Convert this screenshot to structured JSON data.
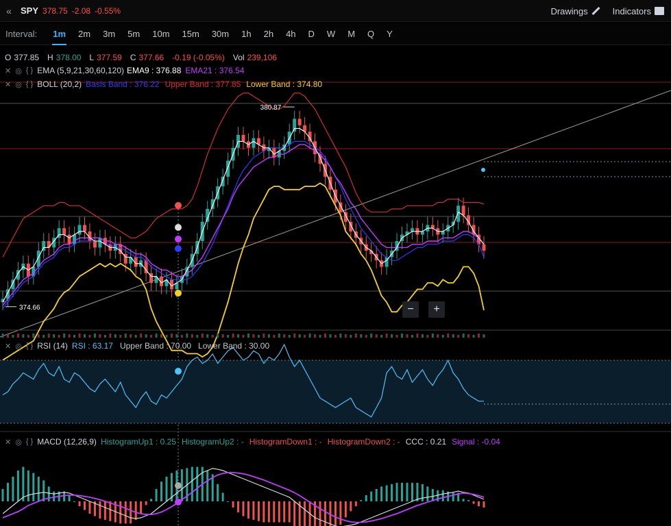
{
  "header": {
    "symbol": "SPY",
    "last": "378.75",
    "change": "-2.08",
    "change_pct": "-0.55%",
    "drawings_label": "Drawings",
    "indicators_label": "Indicators"
  },
  "intervals": {
    "label": "Interval:",
    "items": [
      "1m",
      "2m",
      "3m",
      "5m",
      "10m",
      "15m",
      "30m",
      "1h",
      "2h",
      "4h",
      "D",
      "W",
      "M",
      "Q",
      "Y"
    ],
    "active": "1m"
  },
  "ohlc": {
    "o_label": "O",
    "o": "377.85",
    "h_label": "H",
    "h": "378.00",
    "l_label": "L",
    "l": "377.59",
    "c_label": "C",
    "c": "377.66",
    "chg": "-0.19 (-0.05%)",
    "vol_label": "Vol",
    "vol": "239,106"
  },
  "studies": {
    "ema": {
      "name": "EMA (5,9,21,30,60,120)",
      "ema9": "EMA9 : 376.88",
      "ema21": "EMA21 : 376.54"
    },
    "boll": {
      "name": "BOLL (20,2)",
      "basis": "Basis Band : 376.22",
      "upper": "Upper Band : 377.85",
      "lower": "Lower Band : 374.80"
    },
    "rsi": {
      "name": "RSI (14)",
      "value": "RSI : 63.17",
      "upper": "Upper Band : 70.00",
      "lower": "Lower Band : 30.00"
    },
    "macd": {
      "name": "MACD (12,26,9)",
      "hu1": "HistogramUp1 : 0.25",
      "hu2": "HistogramUp2 : -",
      "hd1": "HistogramDown1 : -",
      "hd2": "HistogramDown2 : -",
      "ccc": "CCC : 0.21",
      "signal": "Signal : -0.04"
    }
  },
  "price_labels": {
    "high": "380.87",
    "low": "374.66"
  },
  "zoom": {
    "minus": "−",
    "plus": "+"
  },
  "colors": {
    "up": "#26a69a",
    "down": "#ef5350",
    "ema_fast": "#ffffff",
    "ema9": "#b0b0ff",
    "ema21": "#c03cff",
    "basis": "#2f3cff",
    "upper": "#d32f2f",
    "lower": "#f5d21e",
    "rsi": "#4fc3f7",
    "macd": "#dddddd",
    "signal": "#c03cff"
  },
  "chart_data": {
    "type": "candlestick",
    "price_series": {
      "name": "SPY",
      "close": [
        374.9,
        375.2,
        375.5,
        375.8,
        376.0,
        375.6,
        375.9,
        376.4,
        376.7,
        376.5,
        376.8,
        377.1,
        376.9,
        376.6,
        376.9,
        377.2,
        377.0,
        376.7,
        376.5,
        376.8,
        376.6,
        376.4,
        376.6,
        376.3,
        376.0,
        376.2,
        375.9,
        376.1,
        375.7,
        375.4,
        375.6,
        375.3,
        375.5,
        375.2,
        375.4,
        375.6,
        375.9,
        376.3,
        376.7,
        377.3,
        377.7,
        378.0,
        378.4,
        378.7,
        379.2,
        379.6,
        380.0,
        379.8,
        379.6,
        379.9,
        379.7,
        379.5,
        379.6,
        379.3,
        379.5,
        379.7,
        380.1,
        380.5,
        380.3,
        380.1,
        379.8,
        379.4,
        379.1,
        378.7,
        378.3,
        377.9,
        377.6,
        377.3,
        377.0,
        376.8,
        376.6,
        376.4,
        376.3,
        376.1,
        375.9,
        376.2,
        376.4,
        376.7,
        376.9,
        377.0,
        377.1,
        376.9,
        377.0,
        377.2,
        377.1,
        376.9,
        377.0,
        377.2,
        377.3,
        377.8,
        377.5,
        377.2,
        376.9,
        376.6,
        376.4
      ]
    },
    "ema_fast": [
      374.8,
      375.1,
      375.4,
      375.7,
      375.9,
      375.8,
      375.9,
      376.2,
      376.5,
      376.5,
      376.7,
      376.9,
      376.9,
      376.8,
      376.9,
      377.0,
      377.0,
      376.8,
      376.7,
      376.7,
      376.6,
      376.5,
      376.5,
      376.4,
      376.2,
      376.2,
      376.0,
      376.0,
      375.8,
      375.6,
      375.6,
      375.4,
      375.5,
      375.3,
      375.4,
      375.5,
      375.8,
      376.1,
      376.5,
      377.0,
      377.4,
      377.8,
      378.2,
      378.6,
      379.0,
      379.4,
      379.8,
      379.8,
      379.7,
      379.8,
      379.7,
      379.6,
      379.6,
      379.4,
      379.5,
      379.6,
      379.9,
      380.2,
      380.2,
      380.1,
      379.9,
      379.6,
      379.3,
      378.9,
      378.5,
      378.1,
      377.8,
      377.5,
      377.2,
      376.9,
      376.7,
      376.5,
      376.4,
      376.2,
      376.0,
      376.1,
      376.3,
      376.5,
      376.8,
      376.9,
      377.0,
      377.0,
      377.0,
      377.1,
      377.1,
      377.0,
      377.0,
      377.1,
      377.2,
      377.6,
      377.5,
      377.3,
      377.0,
      376.8,
      376.6
    ],
    "ema21": [
      374.7,
      374.9,
      375.1,
      375.3,
      375.5,
      375.6,
      375.7,
      375.9,
      376.1,
      376.2,
      376.3,
      376.5,
      376.6,
      376.6,
      376.7,
      376.8,
      376.8,
      376.8,
      376.8,
      376.8,
      376.7,
      376.7,
      376.6,
      376.6,
      376.5,
      376.4,
      376.3,
      376.3,
      376.2,
      376.0,
      375.9,
      375.8,
      375.8,
      375.7,
      375.6,
      375.6,
      375.7,
      375.8,
      376.0,
      376.2,
      376.5,
      376.8,
      377.1,
      377.4,
      377.7,
      378.1,
      378.4,
      378.6,
      378.8,
      379.0,
      379.1,
      379.2,
      379.3,
      379.3,
      379.4,
      379.4,
      379.5,
      379.6,
      379.7,
      379.7,
      379.6,
      379.5,
      379.4,
      379.2,
      379.0,
      378.7,
      378.5,
      378.2,
      377.9,
      377.7,
      377.4,
      377.2,
      377.0,
      376.8,
      376.6,
      376.5,
      376.5,
      376.5,
      376.5,
      376.5,
      376.6,
      376.6,
      376.6,
      376.7,
      376.7,
      376.7,
      376.8,
      376.8,
      376.8,
      376.9,
      377.0,
      377.0,
      376.9,
      376.8,
      376.6
    ],
    "basis": [
      374.6,
      374.8,
      375.0,
      375.2,
      375.4,
      375.5,
      375.6,
      375.8,
      376.0,
      376.1,
      376.2,
      376.4,
      376.5,
      376.5,
      376.6,
      376.7,
      376.7,
      376.7,
      376.7,
      376.7,
      376.6,
      376.6,
      376.5,
      376.5,
      376.4,
      376.3,
      376.2,
      376.2,
      376.1,
      375.9,
      375.8,
      375.7,
      375.6,
      375.5,
      375.5,
      375.5,
      375.5,
      375.6,
      375.8,
      376.0,
      376.3,
      376.6,
      377.0,
      377.4,
      377.8,
      378.2,
      378.6,
      378.9,
      379.1,
      379.3,
      379.4,
      379.5,
      379.6,
      379.6,
      379.6,
      379.6,
      379.7,
      379.8,
      379.8,
      379.8,
      379.7,
      379.6,
      379.5,
      379.3,
      379.0,
      378.7,
      378.4,
      378.0,
      377.7,
      377.4,
      377.1,
      376.9,
      376.7,
      376.5,
      376.3,
      376.2,
      376.1,
      376.1,
      376.2,
      376.3,
      376.4,
      376.5,
      376.5,
      376.6,
      376.6,
      376.6,
      376.7,
      376.7,
      376.7,
      376.8,
      376.9,
      376.9,
      376.8,
      376.6,
      376.2
    ],
    "upper": [
      376.2,
      376.5,
      376.8,
      377.1,
      377.4,
      377.5,
      377.6,
      377.7,
      377.8,
      377.8,
      377.8,
      377.9,
      377.9,
      377.8,
      377.8,
      377.8,
      377.7,
      377.6,
      377.5,
      377.4,
      377.3,
      377.2,
      377.1,
      377.0,
      376.9,
      376.8,
      376.8,
      376.9,
      377.0,
      377.2,
      377.4,
      377.5,
      377.6,
      377.7,
      377.7,
      377.7,
      377.8,
      378.0,
      378.4,
      378.9,
      379.4,
      379.8,
      380.2,
      380.5,
      380.8,
      381.0,
      381.2,
      381.3,
      381.3,
      381.2,
      381.1,
      381.0,
      380.9,
      380.8,
      380.8,
      380.9,
      381.1,
      381.3,
      381.3,
      381.2,
      381.0,
      380.8,
      380.5,
      380.2,
      379.9,
      379.6,
      379.3,
      379.0,
      378.6,
      378.2,
      377.9,
      377.7,
      377.6,
      377.6,
      377.6,
      377.6,
      377.7,
      377.7,
      377.7,
      377.8,
      377.8,
      377.8,
      377.8,
      377.8,
      377.8,
      377.9,
      377.9,
      378.0,
      378.0,
      378.0,
      377.9,
      377.9,
      377.9,
      377.9,
      377.85
    ]
  },
  "rsi_series": [
    48,
    50,
    55,
    58,
    62,
    60,
    58,
    64,
    68,
    62,
    60,
    66,
    58,
    56,
    62,
    60,
    56,
    52,
    50,
    55,
    58,
    54,
    50,
    56,
    48,
    44,
    40,
    46,
    50,
    44,
    42,
    48,
    46,
    50,
    54,
    58,
    66,
    70,
    72,
    68,
    70,
    74,
    68,
    72,
    76,
    78,
    74,
    70,
    72,
    76,
    74,
    68,
    72,
    70,
    74,
    80,
    72,
    66,
    70,
    64,
    58,
    52,
    46,
    44,
    42,
    40,
    42,
    44,
    46,
    40,
    38,
    36,
    34,
    40,
    46,
    62,
    66,
    60,
    58,
    64,
    56,
    60,
    64,
    58,
    54,
    60,
    64,
    70,
    62,
    58,
    52,
    48,
    46,
    44,
    44
  ],
  "macd_series": [
    -0.3,
    -0.2,
    -0.1,
    0.0,
    0.1,
    0.15,
    0.18,
    0.2,
    0.22,
    0.2,
    0.18,
    0.2,
    0.22,
    0.2,
    0.15,
    0.1,
    0.05,
    0.0,
    -0.05,
    -0.1,
    -0.15,
    -0.2,
    -0.25,
    -0.3,
    -0.35,
    -0.4,
    -0.42,
    -0.4,
    -0.35,
    -0.3,
    -0.2,
    -0.1,
    0.0,
    0.1,
    0.2,
    0.3,
    0.4,
    0.5,
    0.6,
    0.7,
    0.75,
    0.8,
    0.78,
    0.75,
    0.7,
    0.65,
    0.6,
    0.55,
    0.5,
    0.45,
    0.4,
    0.35,
    0.3,
    0.25,
    0.2,
    0.15,
    0.1,
    0.0,
    -0.1,
    -0.2,
    -0.3,
    -0.4,
    -0.45,
    -0.5,
    -0.55,
    -0.6,
    -0.62,
    -0.6,
    -0.58,
    -0.55,
    -0.5,
    -0.45,
    -0.4,
    -0.35,
    -0.3,
    -0.25,
    -0.2,
    -0.15,
    -0.1,
    -0.05,
    0.0,
    0.05,
    0.08,
    0.1,
    0.12,
    0.15,
    0.18,
    0.2,
    0.22,
    0.25,
    0.22,
    0.2,
    0.15,
    0.1,
    0.05
  ],
  "signal_series": [
    -0.4,
    -0.35,
    -0.3,
    -0.25,
    -0.18,
    -0.1,
    -0.05,
    0.0,
    0.05,
    0.08,
    0.1,
    0.12,
    0.14,
    0.15,
    0.15,
    0.14,
    0.12,
    0.1,
    0.07,
    0.04,
    0.0,
    -0.04,
    -0.08,
    -0.12,
    -0.17,
    -0.22,
    -0.27,
    -0.3,
    -0.32,
    -0.32,
    -0.3,
    -0.26,
    -0.2,
    -0.13,
    -0.05,
    0.04,
    0.13,
    0.22,
    0.32,
    0.42,
    0.5,
    0.58,
    0.64,
    0.68,
    0.7,
    0.7,
    0.69,
    0.67,
    0.64,
    0.6,
    0.56,
    0.52,
    0.47,
    0.42,
    0.37,
    0.32,
    0.27,
    0.21,
    0.14,
    0.06,
    -0.02,
    -0.1,
    -0.18,
    -0.25,
    -0.32,
    -0.38,
    -0.43,
    -0.47,
    -0.5,
    -0.51,
    -0.51,
    -0.5,
    -0.48,
    -0.45,
    -0.42,
    -0.38,
    -0.34,
    -0.3,
    -0.25,
    -0.2,
    -0.15,
    -0.1,
    -0.06,
    -0.02,
    0.02,
    0.06,
    0.09,
    0.12,
    0.15,
    0.18,
    0.2,
    0.19,
    0.17,
    0.14,
    0.1
  ]
}
